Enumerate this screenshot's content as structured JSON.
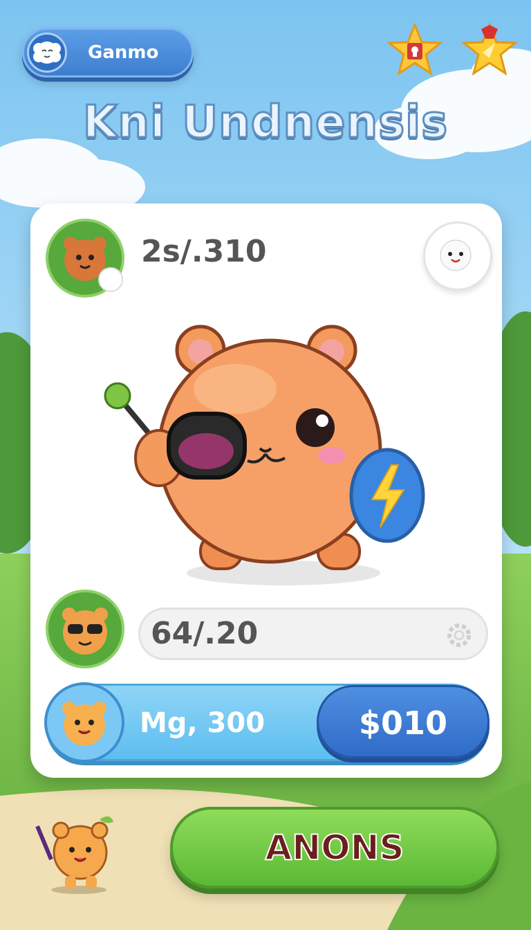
{
  "header": {
    "username": "Ganmo",
    "user_avatar_icon": "fluffy-cloud-face-icon",
    "achievement_icon": "star-badge-icon",
    "favorite_icon": "gold-star-icon"
  },
  "title": "Kni Undnensis",
  "card": {
    "top_stat": {
      "value": "2s/.310",
      "avatar_icon": "bear-portrait-icon",
      "badge_icon": "pencil-badge-icon"
    },
    "corner_button_icon": "cat-face-icon",
    "pet": {
      "icon": "orange-bear-pet-with-sunglasses-and-shield",
      "shield_icon": "lightning-bolt-icon"
    },
    "second_stat": {
      "value": "64/.20",
      "avatar_icon": "bear-with-sunglasses-icon",
      "action_icon": "gear-icon"
    },
    "price_row": {
      "label": "Mg, 300",
      "avatar_icon": "bear-portrait-icon",
      "button_label": "$010"
    }
  },
  "footer": {
    "mascot_icon": "small-bear-mascot-icon",
    "action_button_label": "ANONS"
  },
  "colors": {
    "sky": "#8ecdf2",
    "grass": "#7cc14e",
    "card": "#ffffff",
    "primary_blue": "#3e7ed0",
    "action_green": "#6cc63f",
    "pet_orange": "#f39a5d"
  }
}
